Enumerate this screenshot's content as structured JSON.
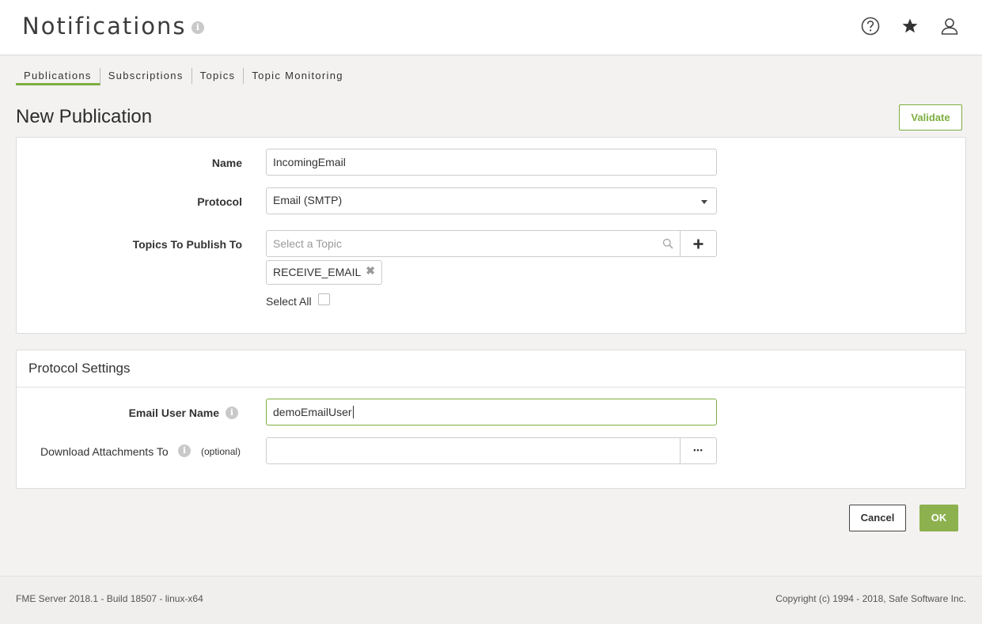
{
  "header": {
    "title": "Notifications",
    "info_icon": "info-icon",
    "icons": [
      "help-circle-icon",
      "star-icon",
      "user-icon"
    ]
  },
  "tabs": [
    {
      "label": "Publications",
      "active": true
    },
    {
      "label": "Subscriptions",
      "active": false
    },
    {
      "label": "Topics",
      "active": false
    },
    {
      "label": "Topic Monitoring",
      "active": false
    }
  ],
  "page": {
    "section_title": "New Publication",
    "validate_label": "Validate"
  },
  "form": {
    "name_label": "Name",
    "name_value": "IncomingEmail",
    "protocol_label": "Protocol",
    "protocol_value": "Email (SMTP)",
    "topics_label": "Topics To Publish To",
    "topics_placeholder": "Select a Topic",
    "selected_topics": [
      "RECEIVE_EMAIL"
    ],
    "select_all_label": "Select All",
    "select_all_checked": false
  },
  "protocol_settings": {
    "title": "Protocol Settings",
    "email_user_label": "Email User Name",
    "email_user_value": "demoEmailUser",
    "download_label": "Download Attachments To",
    "optional_label": "(optional)",
    "download_value": "",
    "browse_label": "•••"
  },
  "actions": {
    "cancel_label": "Cancel",
    "ok_label": "OK"
  },
  "footer": {
    "version": "FME Server 2018.1 - Build 18507 - linux-x64",
    "copyright": "Copyright (c) 1994 - 2018, Safe Software Inc."
  },
  "colors": {
    "accent": "#7dae3f",
    "ok_button": "#8db14e"
  }
}
